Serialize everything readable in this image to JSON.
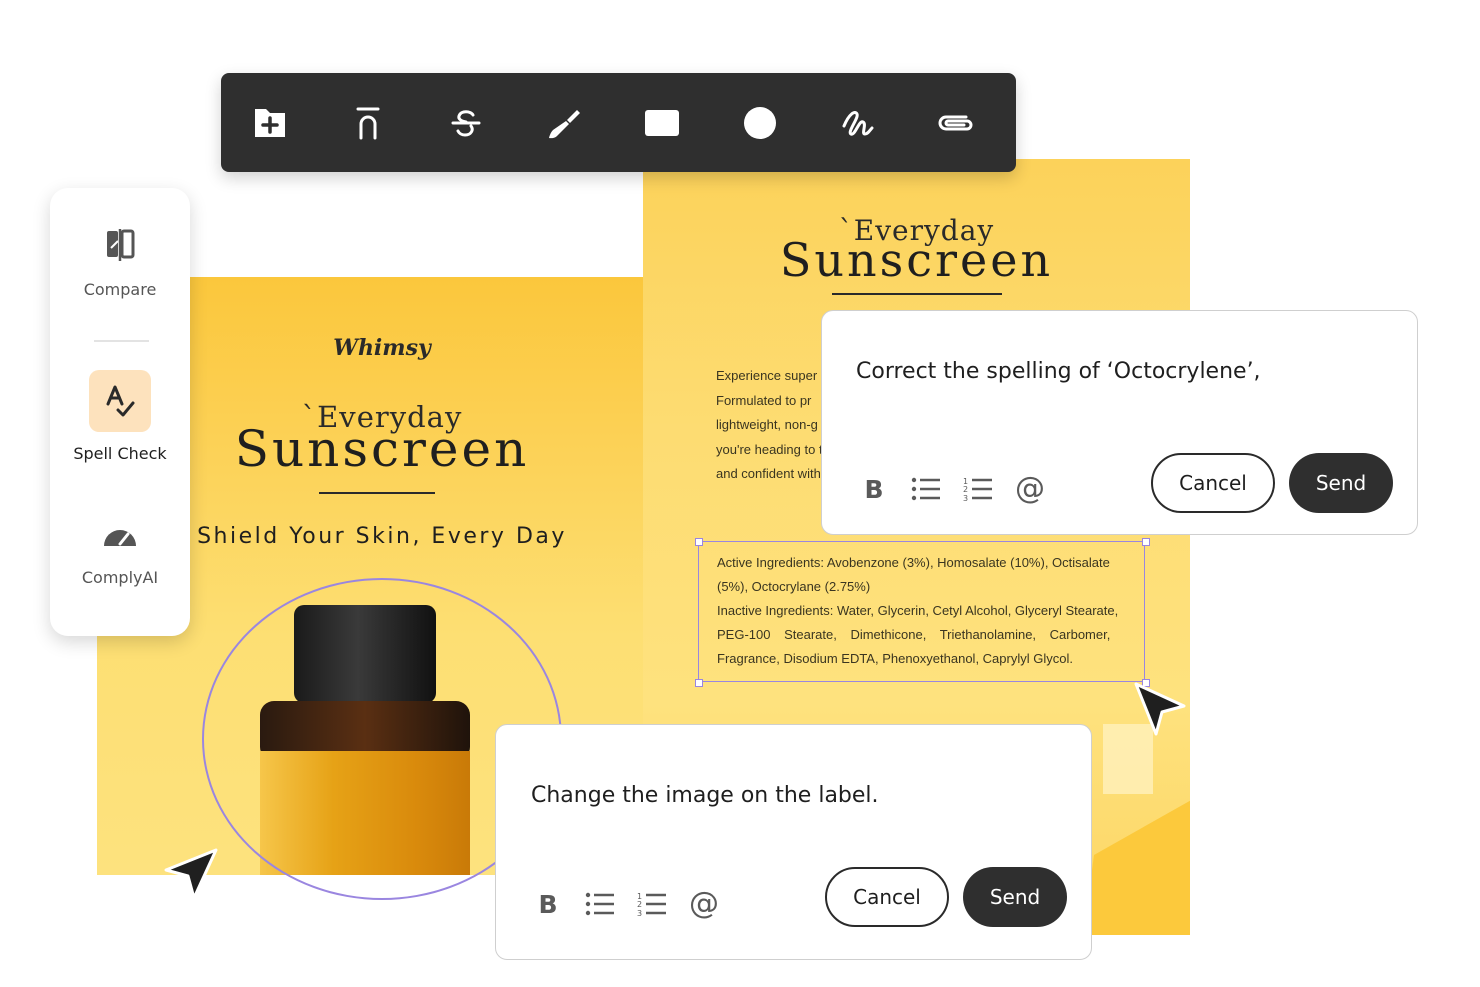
{
  "toolbar": {
    "tools": [
      {
        "name": "add-page-icon"
      },
      {
        "name": "overline-icon"
      },
      {
        "name": "strikethrough-icon"
      },
      {
        "name": "brush-icon"
      },
      {
        "name": "rectangle-icon"
      },
      {
        "name": "circle-icon"
      },
      {
        "name": "signature-icon"
      },
      {
        "name": "attachment-icon"
      }
    ]
  },
  "side_panel": {
    "items": [
      {
        "label": "Compare",
        "icon": "compare-icon"
      },
      {
        "label": "Spell Check",
        "icon": "spell-check-icon"
      },
      {
        "label": "ComplyAI",
        "icon": "gauge-icon"
      }
    ]
  },
  "label_left": {
    "brand": "Whimsy",
    "title_small": "`Everyday",
    "title_big": "Sunscreen",
    "tagline": "Shield Your Skin, Every Day"
  },
  "label_right": {
    "title_small": "`Everyday",
    "title_big": "Sunscreen",
    "paragraph_lines": [
      "Experience super",
      "Formulated to pr",
      "lightweight, non-g",
      "you're heading to t",
      "and confident with"
    ],
    "ingredients_lines": [
      "Active Ingredients: Avobenzone (3%), Homosalate (10%), Octisalate",
      "(5%), Octocrylane (2.75%)",
      "Inactive Ingredients: Water, Glycerin, Cetyl Alcohol, Glyceryl Stearate,",
      "PEG-100 Stearate, Dimethicone, Triethanolamine, Carbomer,",
      "Fragrance, Disodium EDTA, Phenoxyethanol, Caprylyl Glycol."
    ]
  },
  "comment_top": {
    "message": "Correct the spelling of ‘Octocrylene’,",
    "cancel_label": "Cancel",
    "send_label": "Send",
    "bold_label": "B",
    "mention_label": "@"
  },
  "comment_bottom": {
    "message": "Change the image on the label.",
    "cancel_label": "Cancel",
    "send_label": "Send",
    "bold_label": "B",
    "mention_label": "@"
  },
  "colors": {
    "toolbar_bg": "#2f2f2f",
    "label_yellow": "#fcd25a",
    "selection_purple": "#9a86e0",
    "send_button": "#2f2f2f",
    "spell_check_highlight": "#fde2bd"
  }
}
